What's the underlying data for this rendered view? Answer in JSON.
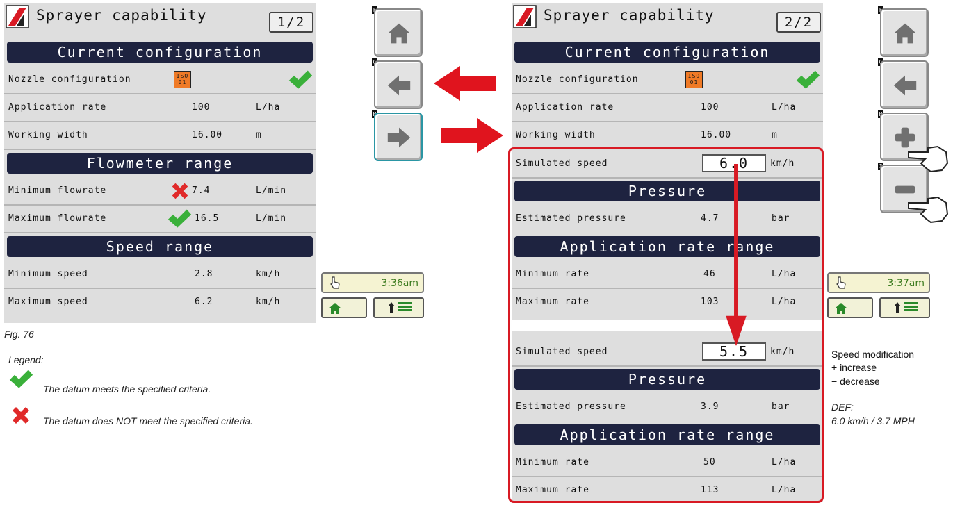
{
  "screen1": {
    "title": "Sprayer capability",
    "page": "1/2",
    "config_header": "Current configuration",
    "nozzle_label": "Nozzle configuration",
    "nozzle_badge": "ISO\n01",
    "app_rate": {
      "label": "Application rate",
      "value": "100",
      "unit": "L/ha"
    },
    "width": {
      "label": "Working width",
      "value": "16.00",
      "unit": "m"
    },
    "flow_header": "Flowmeter range",
    "min_flow": {
      "label": "Minimum flowrate",
      "value": "7.4",
      "unit": "L/min",
      "status": "fail"
    },
    "max_flow": {
      "label": "Maximum flowrate",
      "value": "16.5",
      "unit": "L/min",
      "status": "ok"
    },
    "speed_header": "Speed range",
    "min_speed": {
      "label": "Minimum speed",
      "value": "2.8",
      "unit": "km/h"
    },
    "max_speed": {
      "label": "Maximum speed",
      "value": "6.2",
      "unit": "km/h"
    },
    "time": "3:36am",
    "keys": [
      "F",
      "G",
      "H"
    ]
  },
  "screen2": {
    "title": "Sprayer capability",
    "page": "2/2",
    "config_header": "Current configuration",
    "nozzle_label": "Nozzle configuration",
    "app_rate": {
      "label": "Application rate",
      "value": "100",
      "unit": "L/ha"
    },
    "width": {
      "label": "Working width",
      "value": "16.00",
      "unit": "m"
    },
    "sim_speed_label": "Simulated speed",
    "sim_speed_a": "6.0",
    "sim_speed_unit": "km/h",
    "pressure_header": "Pressure",
    "est_pressure_label": "Estimated pressure",
    "est_pressure_a": "4.7",
    "pressure_unit": "bar",
    "rate_header_a": "Application rate range",
    "min_rate_label": "Minimum rate",
    "min_rate_a": "46",
    "max_rate_label": "Maximum rate",
    "max_rate_a": "103",
    "rate_unit": "L/ha",
    "sim_speed_b": "5.5",
    "est_pressure_b": "3.9",
    "rate_header_b": "Application rate range",
    "min_rate_b": "50",
    "max_rate_b": "113",
    "time": "3:37am",
    "keys": [
      "F",
      "G",
      "H",
      "I"
    ]
  },
  "figure_label": "Fig. 76",
  "legend": {
    "title": "Legend:",
    "ok_text": "The datum meets the specified criteria.",
    "fail_text": "The datum does NOT meet the specified criteria."
  },
  "notes": {
    "speed_mod": "Speed modification",
    "increase": "+ increase",
    "decrease": "− decrease",
    "def_label": "DEF:",
    "def_value": "6.0 km/h / 3.7 MPH"
  },
  "colors": {
    "header_bg": "#1e2340",
    "screen_bg": "#dedede",
    "arrow_red": "#e0141e",
    "check_green": "#3ab03a",
    "cross_red": "#e02a2a",
    "iso_orange": "#ef7a26",
    "highlight_red": "#d81a24"
  }
}
